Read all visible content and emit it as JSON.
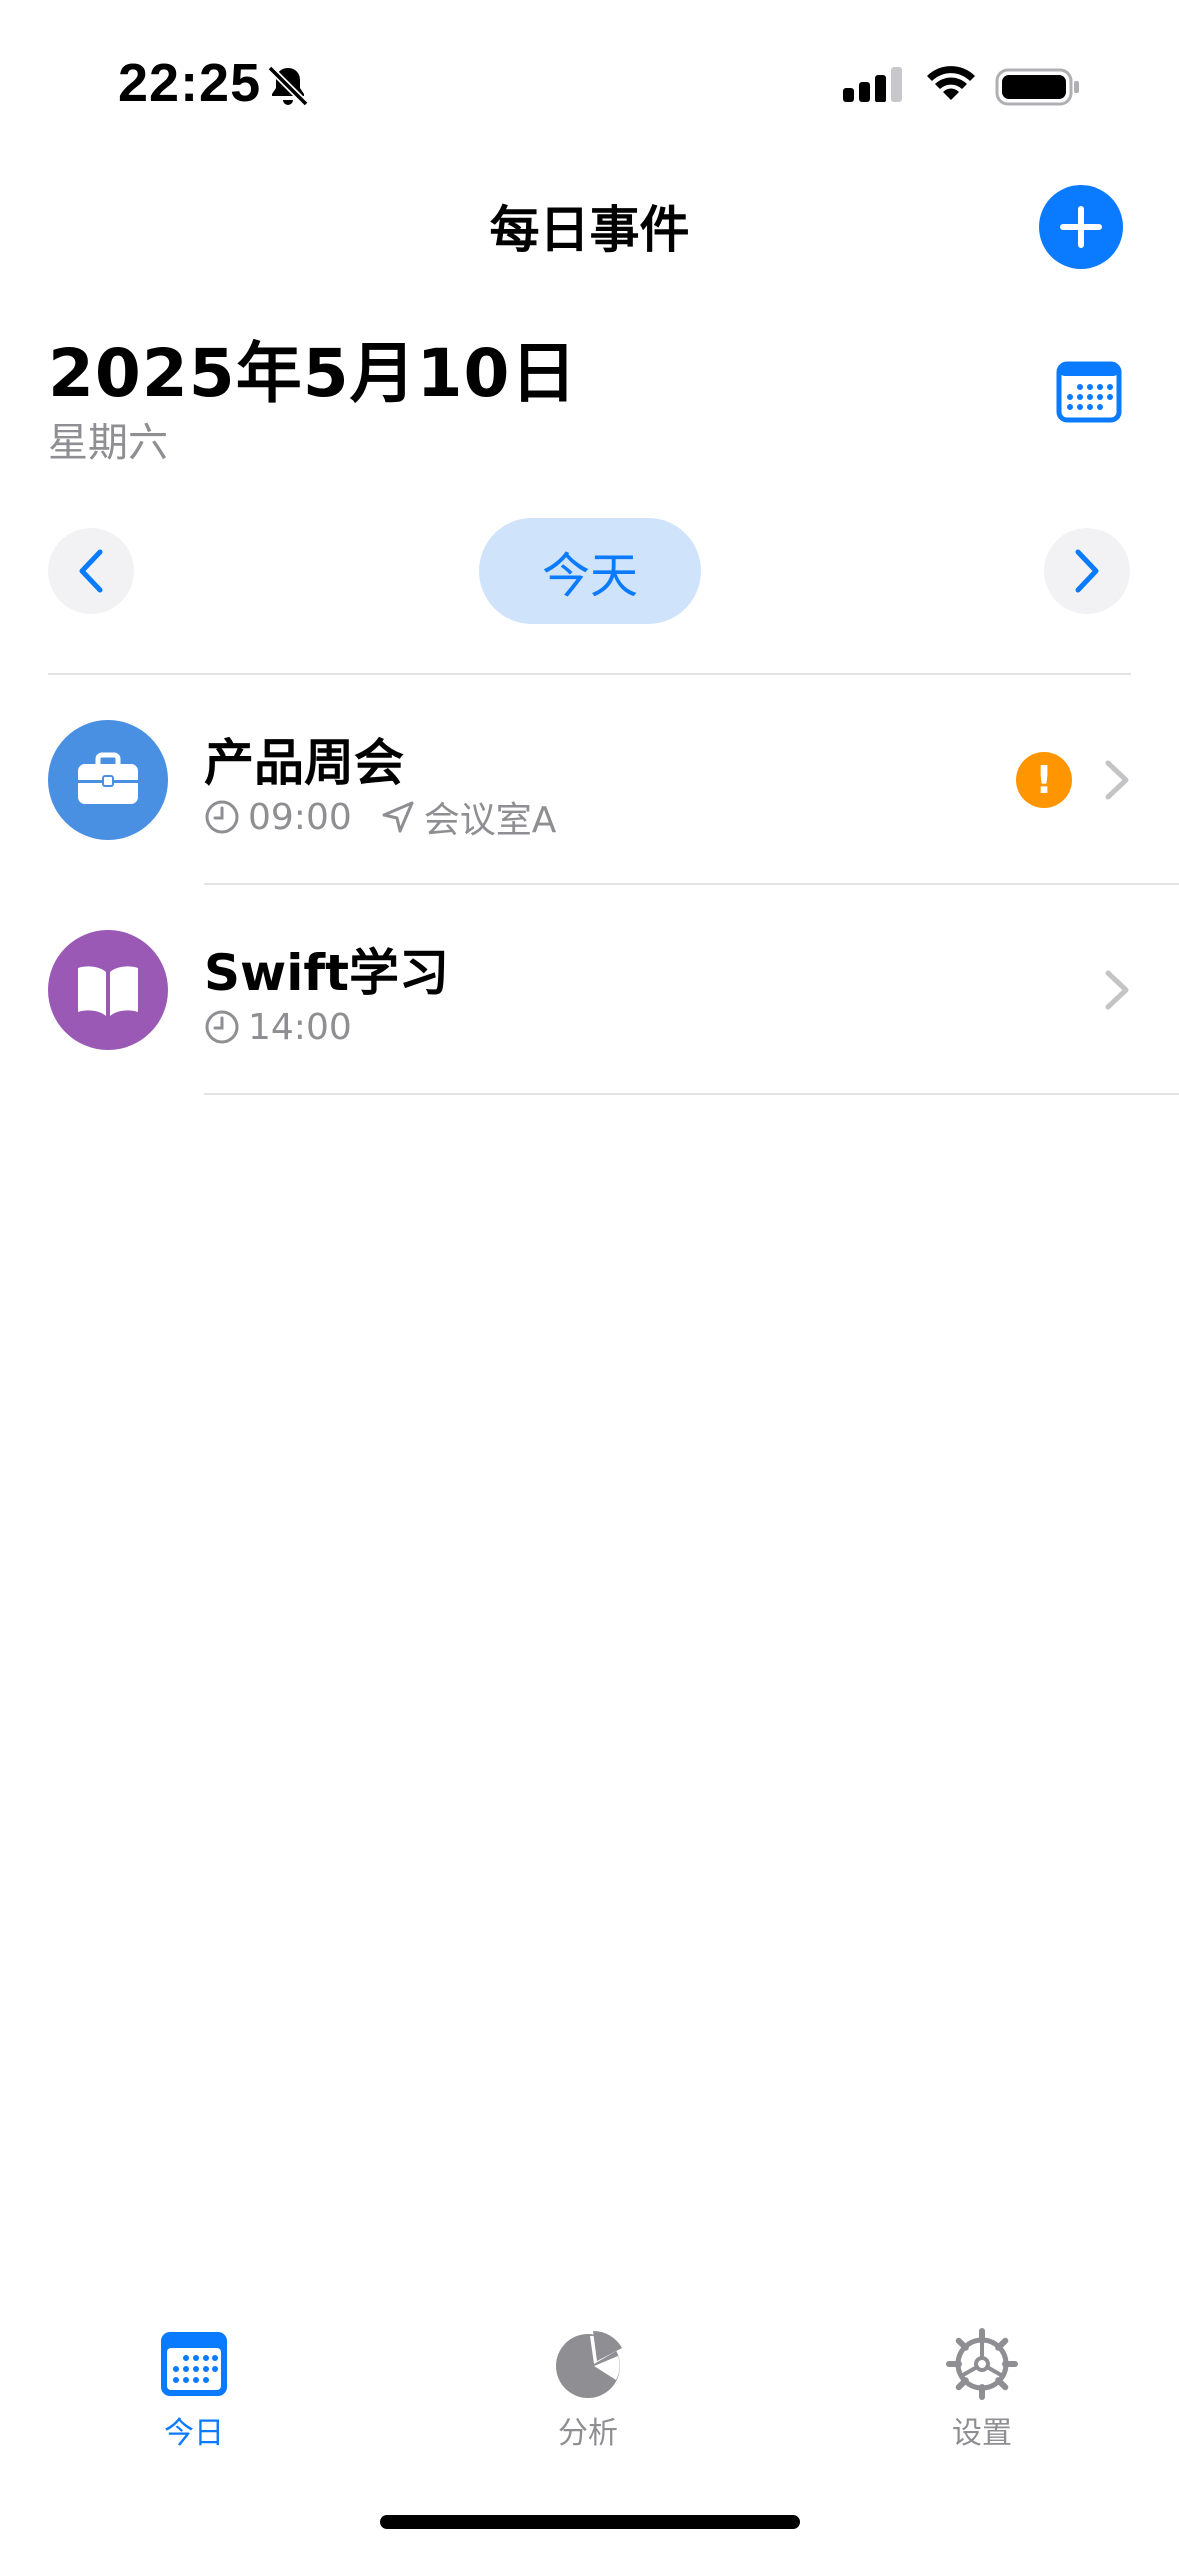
{
  "status_bar": {
    "time": "22:25"
  },
  "header": {
    "title": "每日事件"
  },
  "date_header": {
    "date": "2025年5月10日",
    "weekday": "星期六"
  },
  "day_nav": {
    "today_label": "今天"
  },
  "events": [
    {
      "title": "产品周会",
      "time": "09:00",
      "location": "会议室A",
      "icon": "briefcase-icon",
      "color": "#4a90e2",
      "warning": "!"
    },
    {
      "title": "Swift学习",
      "time": "14:00",
      "icon": "book-icon",
      "color": "#9b59b6"
    }
  ],
  "tab_bar": {
    "items": [
      {
        "label": "今日",
        "icon": "calendar-icon",
        "active": true
      },
      {
        "label": "分析",
        "icon": "pie-chart-icon",
        "active": false
      },
      {
        "label": "设置",
        "icon": "gear-icon",
        "active": false
      }
    ]
  },
  "colors": {
    "accent": "#0a7bff",
    "warning": "#ff9500",
    "secondary_text": "#8e8e93"
  }
}
